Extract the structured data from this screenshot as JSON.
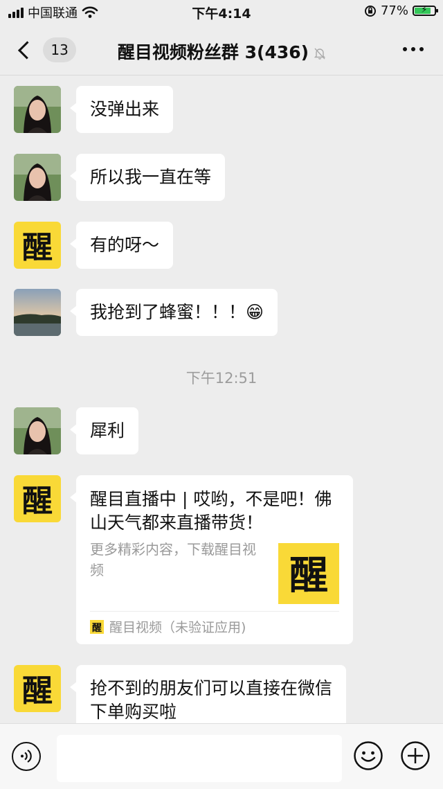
{
  "status_bar": {
    "carrier": "中国联通",
    "time": "下午4:14",
    "battery": "77%"
  },
  "navbar": {
    "back_count": "13",
    "title": "醒目视频粉丝群 3(436)"
  },
  "messages": [
    {
      "text": "没弹出来",
      "avatar": "woman-photo"
    },
    {
      "text": "所以我一直在等",
      "avatar": "woman-photo"
    },
    {
      "text": "有的呀～",
      "avatar": "xingmu-logo"
    },
    {
      "text": "我抢到了蜂蜜！！！",
      "avatar": "landscape-photo",
      "emoji": "😁"
    },
    {
      "text": "犀利",
      "avatar": "woman-photo"
    },
    {
      "text": "抢不到的朋友们可以直接在微信\n下单购买啦",
      "avatar": "xingmu-logo"
    }
  ],
  "timestamp": "下午12:51",
  "link_card": {
    "title": "醒目直播中 | 哎哟，不是吧！佛山天气都来直播带货！",
    "description": "更多精彩内容，下载醒目视频",
    "source": "醒目视频（未验证应用)"
  },
  "colors": {
    "background": "#ededed",
    "bubble": "#ffffff",
    "logo_yellow": "#f9d937",
    "timestamp": "#9c9c9c"
  }
}
